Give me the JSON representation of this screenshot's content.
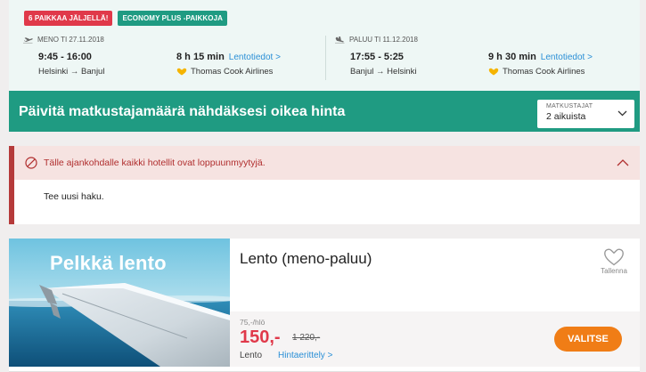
{
  "flight": {
    "badges": [
      "6 PAIKKAA JÄLJELLÄ!",
      "ECONOMY PLUS -PAIKKOJA"
    ],
    "outbound": {
      "header": "MENO TI 27.11.2018",
      "times": "9:45 - 16:00",
      "route": "Helsinki → Banjul",
      "duration": "8 h 15 min",
      "details_link": "Lentotiedot >",
      "airline": "Thomas Cook Airlines"
    },
    "return": {
      "header": "PALUU TI 11.12.2018",
      "times": "17:55 - 5:25",
      "route": "Banjul → Helsinki",
      "duration": "9 h 30 min",
      "details_link": "Lentotiedot >",
      "airline": "Thomas Cook Airlines"
    }
  },
  "travelers": {
    "message": "Päivitä matkustajamäärä nähdäksesi oikea hinta",
    "select_label": "MATKUSTAJAT",
    "select_value": "2 aikuista"
  },
  "alert": {
    "title": "Tälle ajankohdalle kaikki hotellit ovat loppuunmyytyjä.",
    "body": "Tee uusi haku."
  },
  "product": {
    "image_caption": "Pelkkä lento",
    "title": "Lento (meno-paluu)",
    "save_label": "Tallenna",
    "per_person": "75,-/hlö",
    "price": "150,-",
    "old_price": "1 220,-",
    "type": "Lento",
    "price_link": "Hintaerittely >",
    "select_button": "VALITSE"
  },
  "colors": {
    "teal": "#1f9b82",
    "badge_red": "#e0394a",
    "alert_red": "#b53a3a",
    "price_red": "#e0394a",
    "button_orange": "#f07d16",
    "link_blue": "#2a8fd6"
  },
  "icons": [
    "plane-departure-icon",
    "plane-arrival-icon",
    "thomas-cook-heart-icon",
    "chevron-down-icon",
    "prohibited-icon",
    "chevron-up-icon",
    "heart-outline-icon"
  ]
}
